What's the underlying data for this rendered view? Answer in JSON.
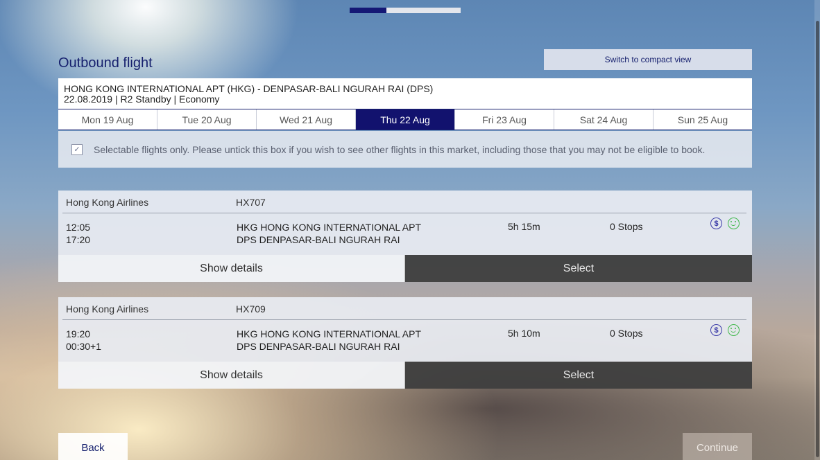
{
  "progress": {
    "fraction": 0.33
  },
  "page": {
    "title": "Outbound flight"
  },
  "toolbar": {
    "compact_label": "Switch to compact view"
  },
  "route": {
    "line1": "HONG KONG INTERNATIONAL APT (HKG) - DENPASAR-BALI NGURAH RAI (DPS)",
    "line2": "22.08.2019 | R2 Standby | Economy"
  },
  "dates": [
    {
      "label": "Mon 19 Aug",
      "active": false
    },
    {
      "label": "Tue 20 Aug",
      "active": false
    },
    {
      "label": "Wed 21 Aug",
      "active": false
    },
    {
      "label": "Thu 22 Aug",
      "active": true
    },
    {
      "label": "Fri 23 Aug",
      "active": false
    },
    {
      "label": "Sat 24 Aug",
      "active": false
    },
    {
      "label": "Sun 25 Aug",
      "active": false
    }
  ],
  "filter": {
    "checked": true,
    "text": "Selectable flights only. Please untick this box if you wish to see other flights in this market, including those that you may not be eligible to book."
  },
  "flights": [
    {
      "airline": "Hong Kong Airlines",
      "number": "HX707",
      "depart": "12:05",
      "arrive": "17:20",
      "from": "HKG HONG KONG INTERNATIONAL APT",
      "to": "DPS DENPASAR-BALI NGURAH RAI",
      "duration": "5h 15m",
      "stops": "0 Stops",
      "details_label": "Show details",
      "select_label": "Select"
    },
    {
      "airline": "Hong Kong Airlines",
      "number": "HX709",
      "depart": "19:20",
      "arrive": "00:30+1",
      "from": "HKG HONG KONG INTERNATIONAL APT",
      "to": "DPS DENPASAR-BALI NGURAH RAI",
      "duration": "5h 10m",
      "stops": "0 Stops",
      "details_label": "Show details",
      "select_label": "Select"
    }
  ],
  "icons": {
    "fare": "dollar-icon",
    "rating": "smile-icon"
  },
  "nav": {
    "back_label": "Back",
    "continue_label": "Continue"
  }
}
